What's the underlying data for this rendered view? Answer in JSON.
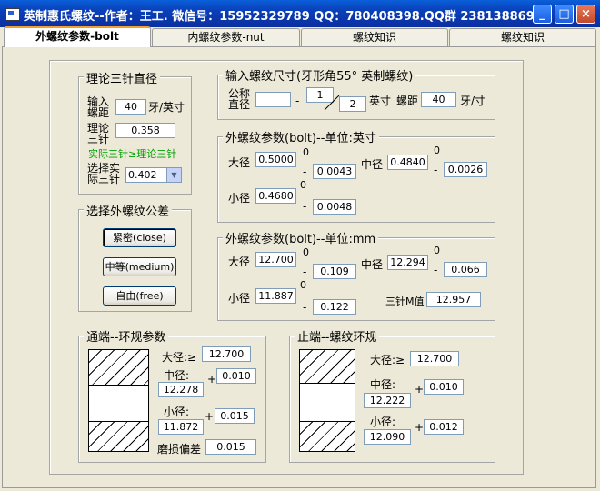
{
  "window": {
    "title": "英制惠氏螺纹--作者：王工. 微信号：15952329789 QQ：780408398.QQ群 238138869",
    "min_label": "_",
    "max_label": "□",
    "close_label": "×"
  },
  "tabs": [
    {
      "label": "外螺纹参数-bolt"
    },
    {
      "label": "内螺纹参数-nut"
    },
    {
      "label": "螺纹知识"
    },
    {
      "label": "螺纹知识"
    }
  ],
  "three_wire": {
    "legend": "理论三针直径",
    "input_pitch_label": "输入\n螺距",
    "pitch_value": "40",
    "pitch_unit": "牙/英寸",
    "theory_label": "理论\n三针",
    "theory_value": "0.358",
    "note": "实际三针≥理论三针",
    "select_label": "选择实\n际三针",
    "select_value": "0.402"
  },
  "tolerance": {
    "legend": "选择外螺纹公差",
    "close_button": "紧密(close)",
    "medium_button": "中等(medium)",
    "free_button": "自由(free)"
  },
  "size_input": {
    "legend": "输入螺纹尺寸(牙形角55° 英制螺纹)",
    "nominal_label": "公称\n直径",
    "nominal_value": "",
    "dash": "-",
    "numerator": "1",
    "denominator": "2",
    "inch_label": "英寸",
    "pitch_label": "螺距",
    "pitch_value": "40",
    "pitch_unit": "牙/寸"
  },
  "bolt_inch": {
    "legend": "外螺纹参数(bolt)--单位:英寸",
    "major_label": "大径",
    "major_value": "0.5000",
    "major_upper": "0",
    "major_lower": "0.0043",
    "pitch_label": "中径",
    "pitch_value": "0.4840",
    "pitch_upper": "0",
    "pitch_lower": "0.0026",
    "minor_label": "小径",
    "minor_value": "0.4680",
    "minor_upper": "0",
    "minor_lower": "0.0048",
    "minus": "-"
  },
  "bolt_mm": {
    "legend": "外螺纹参数(bolt)--单位:mm",
    "major_label": "大径",
    "major_value": "12.700",
    "major_upper": "0",
    "major_lower": "0.109",
    "pitch_label": "中径",
    "pitch_value": "12.294",
    "pitch_upper": "0",
    "pitch_lower": "0.066",
    "minor_label": "小径",
    "minor_value": "11.887",
    "minor_upper": "0",
    "minor_lower": "0.122",
    "m_label": "三针M值",
    "m_value": "12.957",
    "minus": "-"
  },
  "go_ring": {
    "legend": "通端--环规参数",
    "major_label": "大径:≥",
    "major_value": "12.700",
    "pitch_label": "中径:",
    "pitch_value": "12.278",
    "pitch_tol": "0.010",
    "minor_label": "小径:",
    "minor_value": "11.872",
    "minor_tol": "0.015",
    "wear_label": "磨损偏差",
    "wear_value": "0.015",
    "plus": "+"
  },
  "nogo_ring": {
    "legend": "止端--螺纹环规",
    "major_label": "大径:≥",
    "major_value": "12.700",
    "pitch_label": "中径:",
    "pitch_value": "12.222",
    "pitch_tol": "0.010",
    "minor_label": "小径:",
    "minor_value": "12.090",
    "minor_tol": "0.012",
    "plus": "+"
  }
}
